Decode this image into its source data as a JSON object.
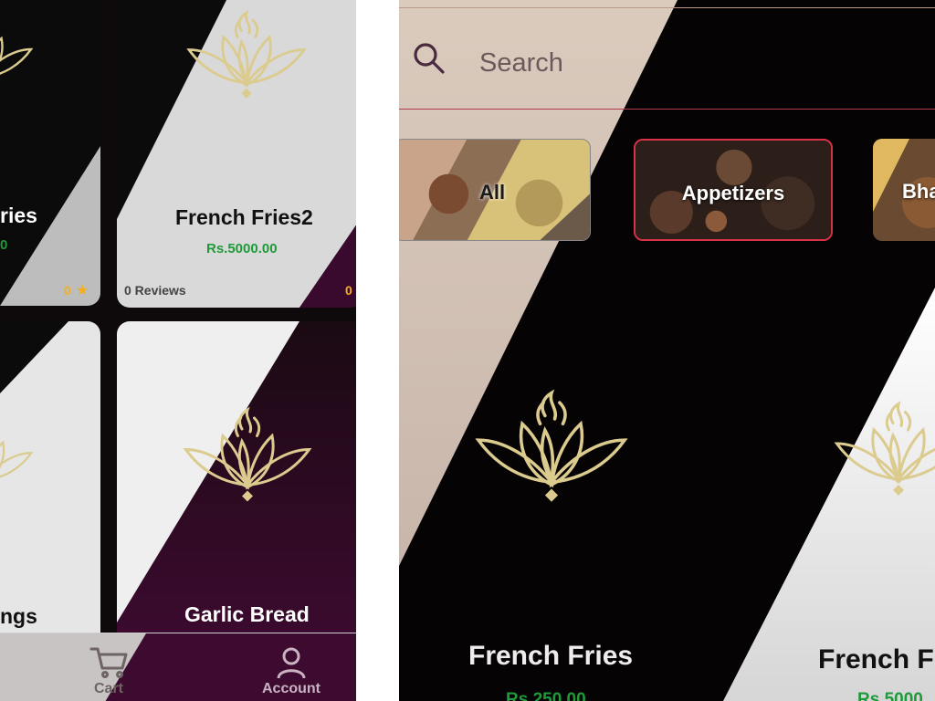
{
  "left_screen": {
    "cards": [
      {
        "title": "ries",
        "price": "0",
        "rating": "0"
      },
      {
        "title": "French Fries2",
        "price": "Rs.5000.00",
        "reviews": "0 Reviews",
        "rating": "0"
      },
      {
        "title": "ngs"
      },
      {
        "title": "Garlic Bread"
      }
    ],
    "bottom_nav": {
      "cart_label": "Cart",
      "account_label": "Account"
    }
  },
  "right_screen": {
    "search": {
      "placeholder": "Search"
    },
    "categories": [
      {
        "label": "All"
      },
      {
        "label": "Appetizers",
        "selected": true
      },
      {
        "label": "Bha"
      }
    ],
    "products": [
      {
        "title": "French Fries",
        "price": "Rs.250.00"
      },
      {
        "title": "French F",
        "price": "Rs.5000"
      }
    ]
  },
  "colors": {
    "brand_plum": "#3b0a2c",
    "lotus_gold": "#d8c890",
    "price_green": "#1f9a3a",
    "star_gold": "#f2b01e",
    "selected_border": "#d8324a"
  },
  "icons": [
    "lotus-logo-icon",
    "star-icon",
    "cart-icon",
    "account-icon",
    "search-icon"
  ]
}
